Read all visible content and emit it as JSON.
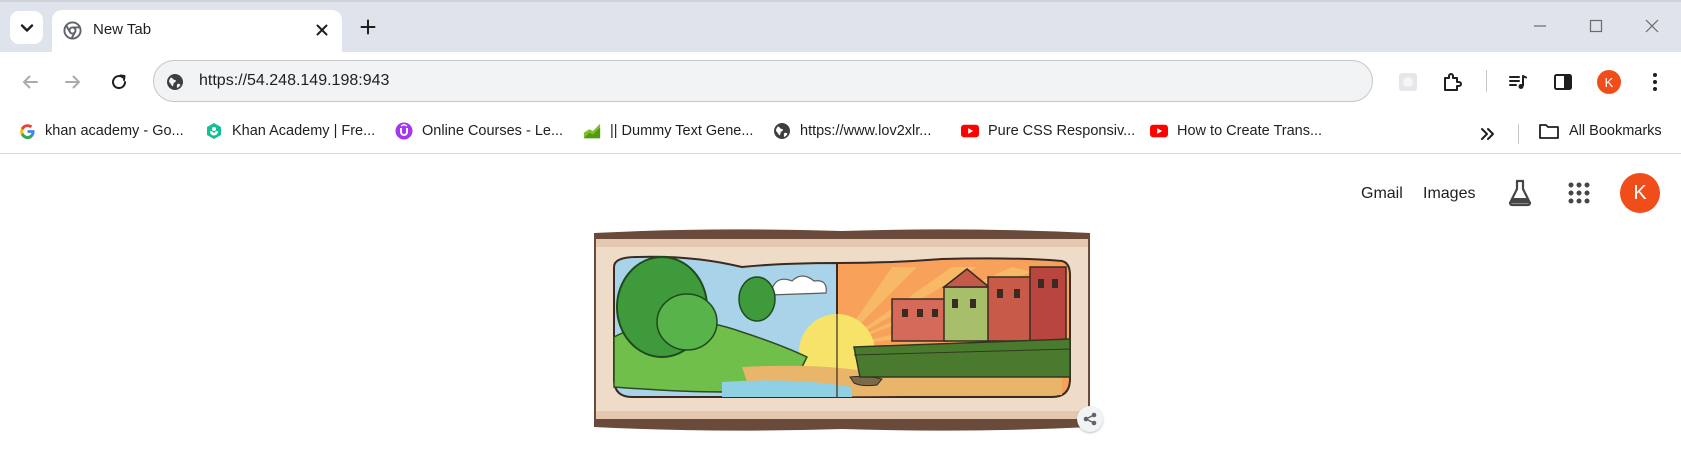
{
  "tab": {
    "title": "New Tab"
  },
  "omnibox": {
    "url": "https://54.248.149.198:943"
  },
  "bookmarks": [
    {
      "label": "khan academy - Go...",
      "icon": "google-icon"
    },
    {
      "label": "Khan Academy | Fre...",
      "icon": "khan-academy-icon"
    },
    {
      "label": "Online Courses - Le...",
      "icon": "udemy-icon"
    },
    {
      "label": "|| Dummy Text Gene...",
      "icon": "dummy-text-icon"
    },
    {
      "label": "https://www.lov2xlr...",
      "icon": "globe-icon"
    },
    {
      "label": "Pure CSS Responsiv...",
      "icon": "youtube-icon"
    },
    {
      "label": "How to Create Trans...",
      "icon": "youtube-icon"
    }
  ],
  "bookmarks_all": "All Bookmarks",
  "page": {
    "gmail": "Gmail",
    "images": "Images",
    "avatar_letter": "K"
  },
  "profile_letter": "K",
  "colors": {
    "tabstrip": "#dfe3eb",
    "avatar": "#f04d1a",
    "omnibox": "#f1f3f4"
  }
}
